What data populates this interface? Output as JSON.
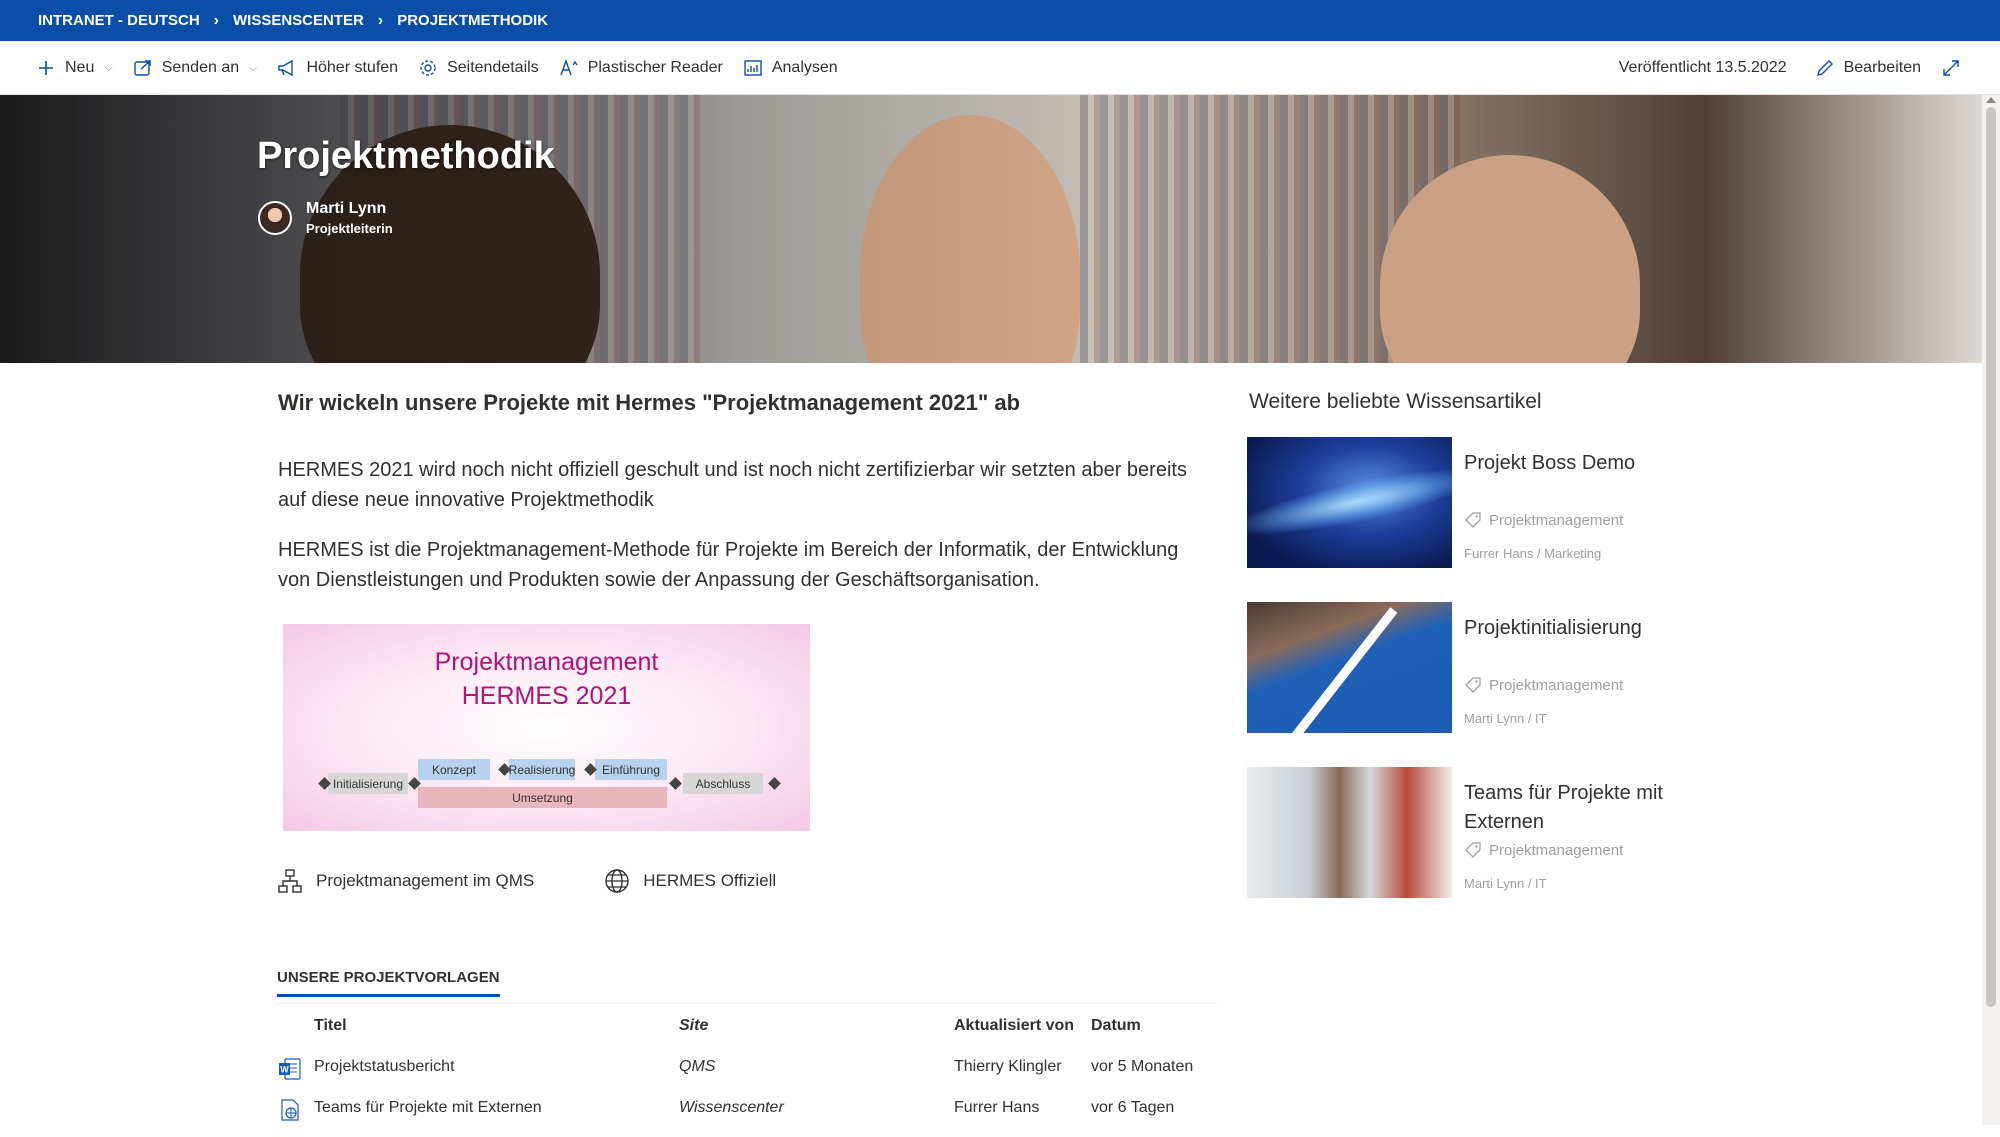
{
  "breadcrumb": [
    "INTRANET - DEUTSCH",
    "WISSENSCENTER",
    "PROJEKTMETHODIK"
  ],
  "commands": {
    "new": "Neu",
    "send": "Senden an",
    "promote": "Höher stufen",
    "page_details": "Seitendetails",
    "reader": "Plastischer Reader",
    "analytics": "Analysen",
    "published": "Veröffentlicht 13.5.2022",
    "edit": "Bearbeiten"
  },
  "hero": {
    "title": "Projektmethodik",
    "author_name": "Marti Lynn",
    "author_role": "Projektleiterin"
  },
  "main": {
    "heading": "Wir wickeln unsere Projekte mit Hermes \"Projektmanagement 2021\" ab",
    "para1": "HERMES 2021 wird noch nicht offiziell geschult und ist noch nicht zertifizierbar wir setzten aber bereits auf diese neue innovative Projektmethodik",
    "para2": "HERMES ist die Projektmanagement-Methode für Projekte im Bereich der Informatik, der Entwicklung von Dienstleistungen und Produkten sowie der Anpassung der Geschäftsorganisation.",
    "banner": {
      "line1": "Projektmanagement",
      "line2": "HERMES 2021",
      "phases": {
        "init": "Initialisierung",
        "concept": "Konzept",
        "realization": "Realisierung",
        "introduction": "Einführung",
        "closing": "Abschluss",
        "implementation": "Umsetzung"
      }
    },
    "links": [
      "Projektmanagement im QMS",
      "HERMES Offiziell"
    ],
    "section_title": "UNSERE PROJEKTVORLAGEN",
    "table": {
      "headers": {
        "title": "Titel",
        "site": "Site",
        "updated_by": "Aktualisiert von",
        "date": "Datum"
      },
      "rows": [
        {
          "title": "Projektstatusbericht",
          "site": "QMS",
          "updated_by": "Thierry Klingler",
          "date": "vor 5 Monaten",
          "icon": "word-doc-icon"
        },
        {
          "title": "Teams für Projekte mit Externen",
          "site": "Wissenscenter",
          "updated_by": "Furrer Hans",
          "date": "vor 6 Tagen",
          "icon": "web-page-icon"
        }
      ]
    }
  },
  "sidebar": {
    "title": "Weitere beliebte Wissensartikel",
    "articles": [
      {
        "title": "Projekt Boss Demo",
        "tag": "Projektmanagement",
        "meta": "Furrer Hans / Marketing"
      },
      {
        "title": "Projektinitialisierung",
        "tag": "Projektmanagement",
        "meta": "Marti Lynn / IT"
      },
      {
        "title": "Teams für Projekte mit Externen",
        "tag": "Projektmanagement",
        "meta": "Marti Lynn / IT"
      }
    ]
  },
  "colors": {
    "brand": "#0a4ea7",
    "accent_pink": "#b1127a"
  }
}
